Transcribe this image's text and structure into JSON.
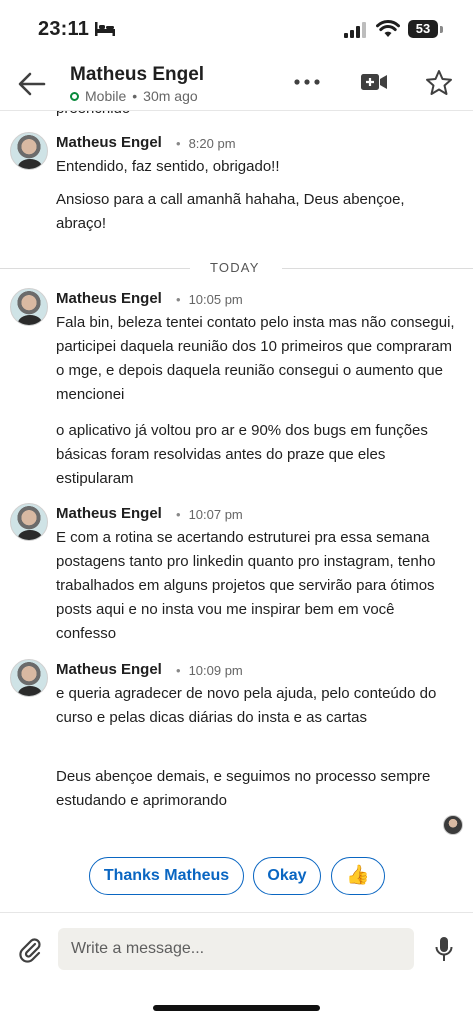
{
  "status_bar": {
    "time": "23:11",
    "battery": "53"
  },
  "header": {
    "contact_name": "Matheus Engel",
    "presence_device": "Mobile",
    "presence_separator": "•",
    "presence_time": "30m ago"
  },
  "conversation": {
    "cut_off_text": "preenchido",
    "today_label": "TODAY",
    "groups": [
      {
        "sender": "Matheus Engel",
        "time": "8:20 pm",
        "messages": [
          "Entendido, faz sentido, obrigado!!",
          "Ansioso para a call amanhã hahaha, Deus abençoe, abraço!"
        ]
      },
      {
        "sender": "Matheus Engel",
        "time": "10:05 pm",
        "messages": [
          "Fala bin, beleza tentei contato pelo insta mas não consegui, participei daquela reunião dos 10 primeiros que compraram o mge, e depois daquela reunião consegui o aumento que mencionei",
          "o aplicativo já voltou pro ar e 90% dos bugs em funções básicas foram resolvidas antes do praze que eles estipularam"
        ]
      },
      {
        "sender": "Matheus Engel",
        "time": "10:07 pm",
        "messages": [
          "E com a rotina se acertando estruturei pra essa semana postagens tanto pro linkedin quanto pro instagram, tenho trabalhados em alguns projetos que servirão para ótimos posts aqui e no insta vou me inspirar bem em você confesso"
        ]
      },
      {
        "sender": "Matheus Engel",
        "time": "10:09 pm",
        "messages": [
          "e queria agradecer de novo pela ajuda, pelo conteúdo do curso e pelas dicas diárias do insta e as cartas",
          "Deus abençoe demais, e seguimos no processo sempre estudando e aprimorando"
        ]
      }
    ]
  },
  "suggested_replies": [
    "Thanks Matheus",
    "Okay",
    "👍"
  ],
  "composer": {
    "placeholder": "Write a message..."
  },
  "colors": {
    "accent": "#0a66c2",
    "presence": "#0a8a3c"
  }
}
